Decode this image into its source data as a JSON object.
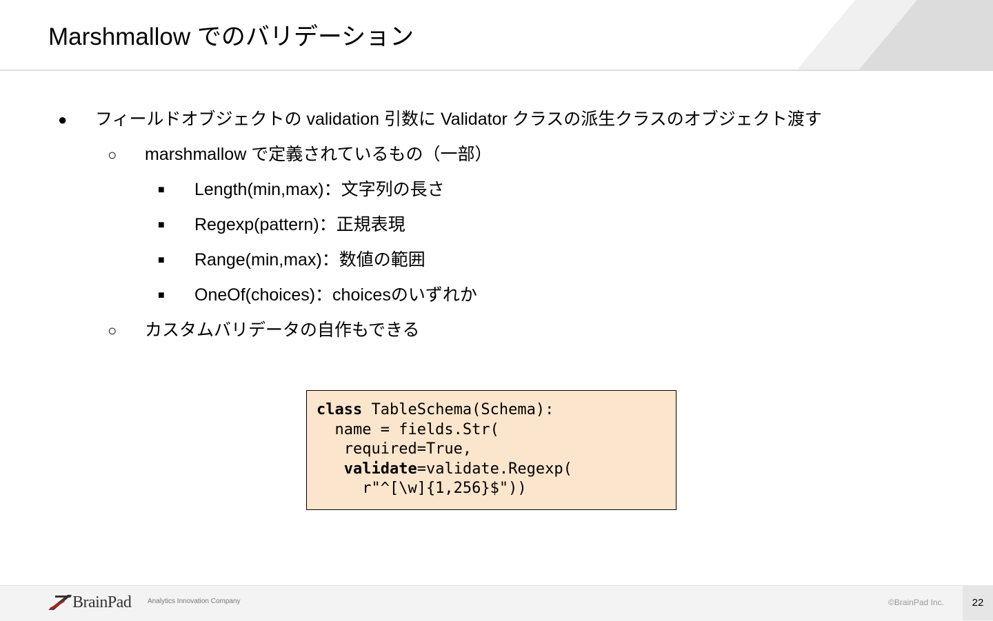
{
  "slide": {
    "title": "Marshmallow でのバリデーション",
    "page_number": "22"
  },
  "bullets": [
    {
      "level": 1,
      "marker": "●",
      "text": "フィールドオブジェクトの  validation 引数に Validator クラスの派生クラスのオブジェクト渡す"
    },
    {
      "level": 2,
      "marker": "○",
      "text": "marshmallow で定義されているもの（一部）"
    },
    {
      "level": 3,
      "marker": "■",
      "text": "Length(min,max)：文字列の長さ"
    },
    {
      "level": 3,
      "marker": "■",
      "text": "Regexp(pattern)：正規表現"
    },
    {
      "level": 3,
      "marker": "■",
      "text": "Range(min,max)：数値の範囲"
    },
    {
      "level": 3,
      "marker": "■",
      "text": "OneOf(choices)：choicesのいずれか"
    },
    {
      "level": 2,
      "marker": "○",
      "text": "カスタムバリデータの自作もできる"
    }
  ],
  "code": {
    "background": "#fce5cd",
    "lines": [
      {
        "kw": "class",
        "rest": " TableSchema(Schema):"
      },
      {
        "kw": "",
        "rest": "  name = fields.Str("
      },
      {
        "kw": "",
        "rest": "   required=True,"
      },
      {
        "indent": "   ",
        "kw": "validate",
        "rest": "=validate.Regexp("
      },
      {
        "kw": "",
        "rest": "     r\"^[\\w]{1,256}$\"))"
      }
    ]
  },
  "footer": {
    "brand": "BrainPad",
    "tagline": "Analytics Innovation Company",
    "copyright": "©BrainPad Inc."
  }
}
